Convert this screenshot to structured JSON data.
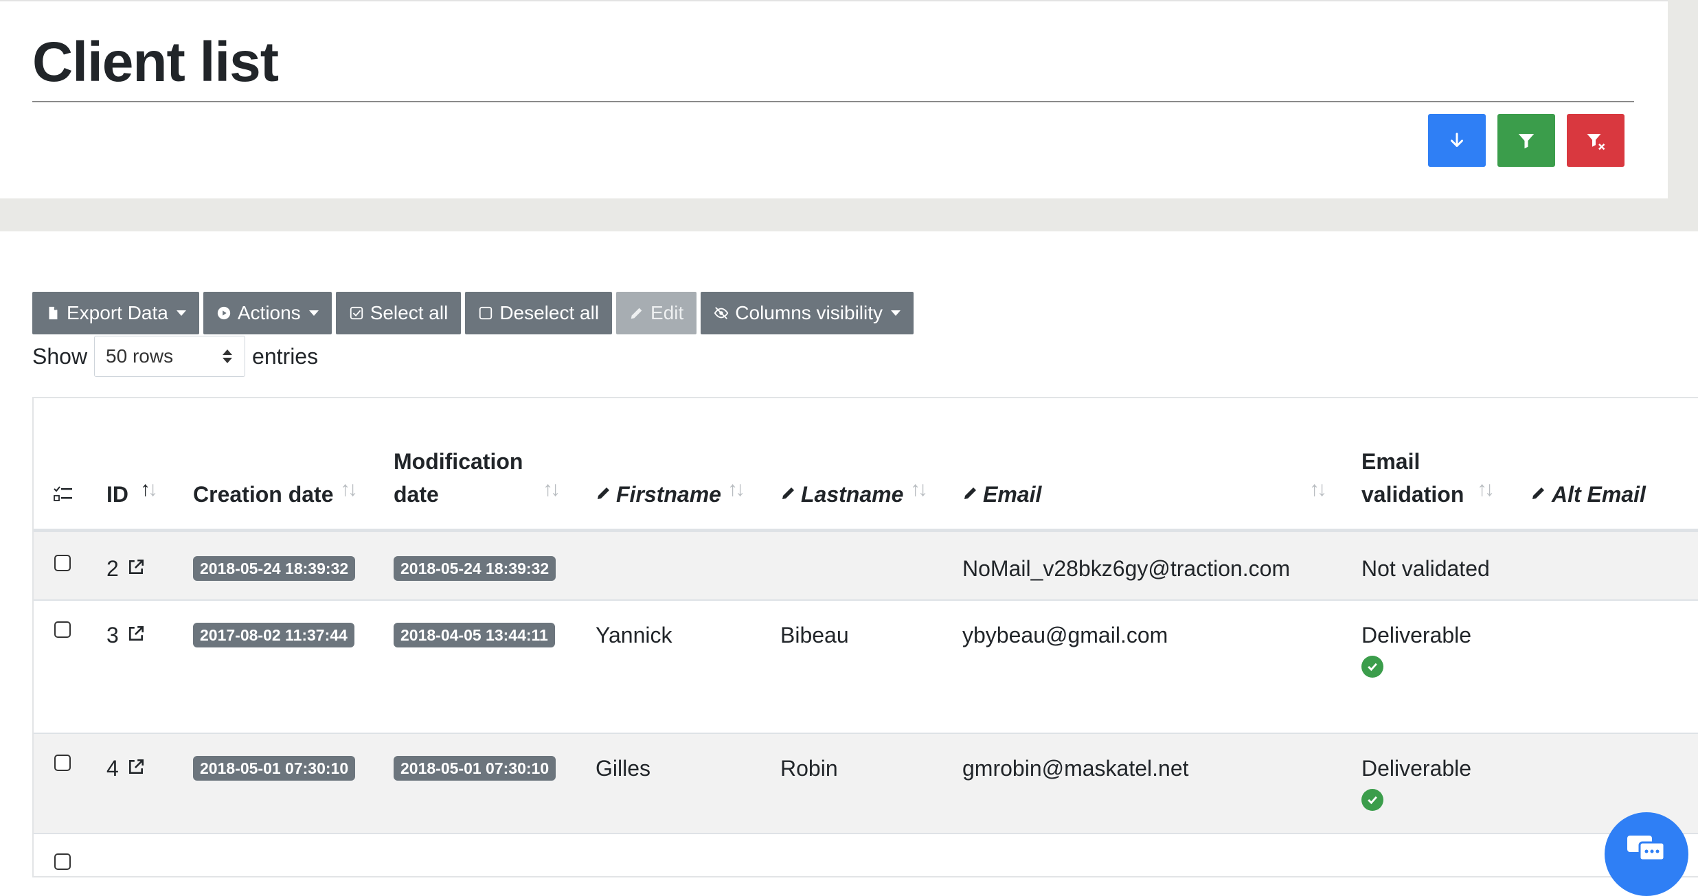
{
  "page": {
    "title": "Client list"
  },
  "header_actions": {
    "download": "arrow-down-icon",
    "filter": "filter-icon",
    "clear_filter": "filter-clear-icon",
    "colors": {
      "download": "#2f7ff5",
      "filter": "#3b9d4b",
      "clear_filter": "#d9383f"
    }
  },
  "toolbar": {
    "export": "Export Data",
    "actions": "Actions",
    "select_all": "Select all",
    "deselect_all": "Deselect all",
    "edit": "Edit",
    "columns_visibility": "Columns visibility"
  },
  "length": {
    "show": "Show",
    "selected": "50 rows",
    "entries": "entries"
  },
  "table": {
    "columns": {
      "id": "ID",
      "creation_date": "Creation date",
      "modification_date_1": "Modification",
      "modification_date_2": "date",
      "firstname": "Firstname",
      "lastname": "Lastname",
      "email": "Email",
      "email_validation_1": "Email",
      "email_validation_2": "validation",
      "alt_email": "Alt Email"
    },
    "rows": [
      {
        "id": "2",
        "created": "2018-05-24 18:39:32",
        "modified": "2018-05-24 18:39:32",
        "firstname": "",
        "lastname": "",
        "email": "NoMail_v28bkz6gy@traction.com",
        "validation": "Not validated"
      },
      {
        "id": "3",
        "created": "2017-08-02 11:37:44",
        "modified": "2018-04-05 13:44:11",
        "firstname": "Yannick",
        "lastname": "Bibeau",
        "email": "ybybeau@gmail.com",
        "validation": "Deliverable"
      },
      {
        "id": "4",
        "created": "2018-05-01 07:30:10",
        "modified": "2018-05-01 07:30:10",
        "firstname": "Gilles",
        "lastname": "Robin",
        "email": "gmrobin@maskatel.net",
        "validation": "Deliverable"
      }
    ]
  }
}
